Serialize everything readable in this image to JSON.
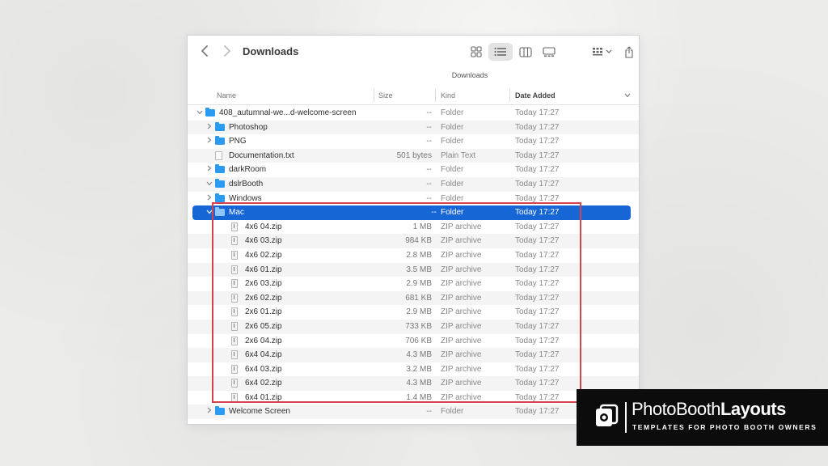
{
  "window": {
    "title": "Downloads",
    "path_label": "Downloads"
  },
  "toolbar": {
    "back_icon": "chevron-left-icon",
    "forward_icon": "chevron-right-icon",
    "views": [
      "icon-view-icon",
      "list-view-icon",
      "column-view-icon",
      "gallery-view-icon"
    ],
    "active_view": "list-view-icon",
    "group_icon": "group-by-icon",
    "share_icon": "share-icon"
  },
  "columns": {
    "name": "Name",
    "size": "Size",
    "kind": "Kind",
    "date": "Date Added"
  },
  "rows": [
    {
      "level": 0,
      "disc": "v",
      "icon": "folder",
      "name": "408_autumnal-we...d-welcome-screen",
      "size": "--",
      "kind": "Folder",
      "date": "Today 17:27"
    },
    {
      "level": 1,
      "disc": ">",
      "icon": "folder",
      "name": "Photoshop",
      "size": "--",
      "kind": "Folder",
      "date": "Today 17:27"
    },
    {
      "level": 1,
      "disc": ">",
      "icon": "folder",
      "name": "PNG",
      "size": "--",
      "kind": "Folder",
      "date": "Today 17:27"
    },
    {
      "level": 1,
      "disc": "",
      "icon": "file",
      "name": "Documentation.txt",
      "size": "501 bytes",
      "kind": "Plain Text",
      "date": "Today 17:27"
    },
    {
      "level": 1,
      "disc": ">",
      "icon": "folder",
      "name": "darkRoom",
      "size": "--",
      "kind": "Folder",
      "date": "Today 17:27"
    },
    {
      "level": 1,
      "disc": "v",
      "icon": "folder",
      "name": "dslrBooth",
      "size": "--",
      "kind": "Folder",
      "date": "Today 17:27"
    },
    {
      "level": 2,
      "disc": ">",
      "icon": "folder",
      "name": "Windows",
      "size": "--",
      "kind": "Folder",
      "date": "Today 17:27"
    },
    {
      "level": 2,
      "disc": "v",
      "icon": "folder",
      "name": "Mac",
      "size": "--",
      "kind": "Folder",
      "date": "Today 17:27",
      "selected": true
    },
    {
      "level": 3,
      "disc": "",
      "icon": "zip",
      "name": "4x6 04.zip",
      "size": "1 MB",
      "kind": "ZIP archive",
      "date": "Today 17:27"
    },
    {
      "level": 3,
      "disc": "",
      "icon": "zip",
      "name": "4x6 03.zip",
      "size": "984 KB",
      "kind": "ZIP archive",
      "date": "Today 17:27"
    },
    {
      "level": 3,
      "disc": "",
      "icon": "zip",
      "name": "4x6 02.zip",
      "size": "2.8 MB",
      "kind": "ZIP archive",
      "date": "Today 17:27"
    },
    {
      "level": 3,
      "disc": "",
      "icon": "zip",
      "name": "4x6 01.zip",
      "size": "3.5 MB",
      "kind": "ZIP archive",
      "date": "Today 17:27"
    },
    {
      "level": 3,
      "disc": "",
      "icon": "zip",
      "name": "2x6 03.zip",
      "size": "2.9 MB",
      "kind": "ZIP archive",
      "date": "Today 17:27"
    },
    {
      "level": 3,
      "disc": "",
      "icon": "zip",
      "name": "2x6 02.zip",
      "size": "681 KB",
      "kind": "ZIP archive",
      "date": "Today 17:27"
    },
    {
      "level": 3,
      "disc": "",
      "icon": "zip",
      "name": "2x6 01.zip",
      "size": "2.9 MB",
      "kind": "ZIP archive",
      "date": "Today 17:27"
    },
    {
      "level": 3,
      "disc": "",
      "icon": "zip",
      "name": "2x6 05.zip",
      "size": "733 KB",
      "kind": "ZIP archive",
      "date": "Today 17:27"
    },
    {
      "level": 3,
      "disc": "",
      "icon": "zip",
      "name": "2x6 04.zip",
      "size": "706 KB",
      "kind": "ZIP archive",
      "date": "Today 17:27"
    },
    {
      "level": 3,
      "disc": "",
      "icon": "zip",
      "name": "6x4 04.zip",
      "size": "4.3 MB",
      "kind": "ZIP archive",
      "date": "Today 17:27"
    },
    {
      "level": 3,
      "disc": "",
      "icon": "zip",
      "name": "6x4 03.zip",
      "size": "3.2 MB",
      "kind": "ZIP archive",
      "date": "Today 17:27"
    },
    {
      "level": 3,
      "disc": "",
      "icon": "zip",
      "name": "6x4 02.zip",
      "size": "4.3 MB",
      "kind": "ZIP archive",
      "date": "Today 17:27"
    },
    {
      "level": 3,
      "disc": "",
      "icon": "zip",
      "name": "6x4 01.zip",
      "size": "1.4 MB",
      "kind": "ZIP archive",
      "date": "Today 17:27"
    },
    {
      "level": 1,
      "disc": ">",
      "icon": "folder",
      "name": "Welcome Screen",
      "size": "--",
      "kind": "Folder",
      "date": "Today 17:27"
    }
  ],
  "colors": {
    "selection": "#1766d6",
    "folder": "#2a9bf0",
    "highlight_box": "#d9424c"
  },
  "brand": {
    "name_light": "PhotoBooth",
    "name_bold": "Layouts",
    "tagline": "TEMPLATES FOR PHOTO BOOTH OWNERS",
    "logo_icon": "photobooth-layouts-logo"
  }
}
